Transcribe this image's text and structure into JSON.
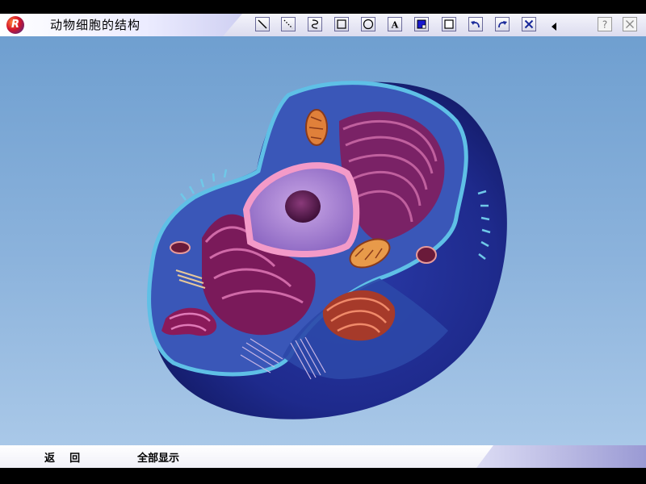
{
  "window": {
    "title": "动物细胞的结构",
    "logo_letter": "R"
  },
  "toolbar": {
    "tools": [
      {
        "name": "line-tool-icon"
      },
      {
        "name": "dotted-line-tool-icon"
      },
      {
        "name": "freehand-tool-icon"
      },
      {
        "name": "rectangle-tool-icon"
      },
      {
        "name": "ellipse-tool-icon"
      },
      {
        "name": "text-tool-icon",
        "glyph": "A"
      },
      {
        "name": "fill-color-tool-icon"
      },
      {
        "name": "square-outline-tool-icon"
      },
      {
        "name": "undo-icon"
      },
      {
        "name": "redo-icon"
      },
      {
        "name": "clear-icon"
      },
      {
        "name": "collapse-arrow-icon"
      },
      {
        "name": "help-icon",
        "glyph": "?"
      },
      {
        "name": "close-icon"
      }
    ]
  },
  "nav": {
    "back_label": "返    回",
    "show_all_label": "全部显示"
  },
  "colors": {
    "background_top": "#6f9fd0",
    "background_bottom": "#a9c8e8",
    "accent": "#2b2b9a"
  }
}
